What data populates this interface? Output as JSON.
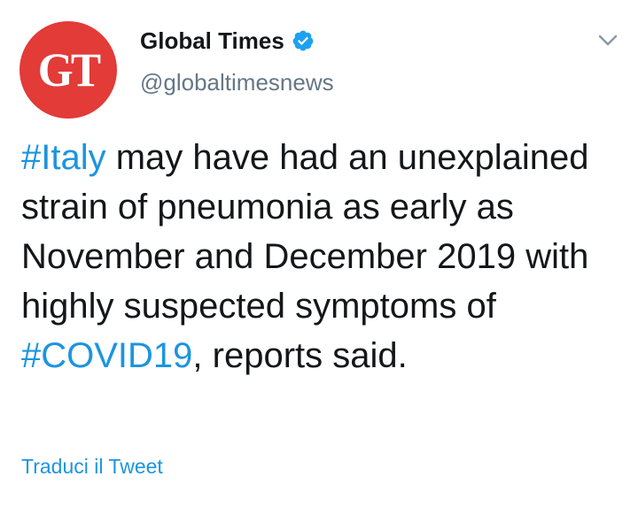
{
  "author": {
    "avatar_text": "GT",
    "display_name": "Global Times",
    "handle": "@globaltimesnews",
    "verified": true,
    "avatar_color": "#e23b38"
  },
  "tweet": {
    "hashtag_1": "#Italy",
    "text_1": " may have had an unexplained strain of pneumonia as early as November and December 2019 with highly suspected symptoms of ",
    "hashtag_2": "#COVID19",
    "text_2": ", reports said."
  },
  "actions": {
    "translate_label": "Traduci il Tweet",
    "menu_icon": "chevron-down-icon"
  },
  "colors": {
    "link": "#1b95e0",
    "text": "#14171a",
    "secondary": "#657786",
    "verified": "#1da1f2"
  }
}
